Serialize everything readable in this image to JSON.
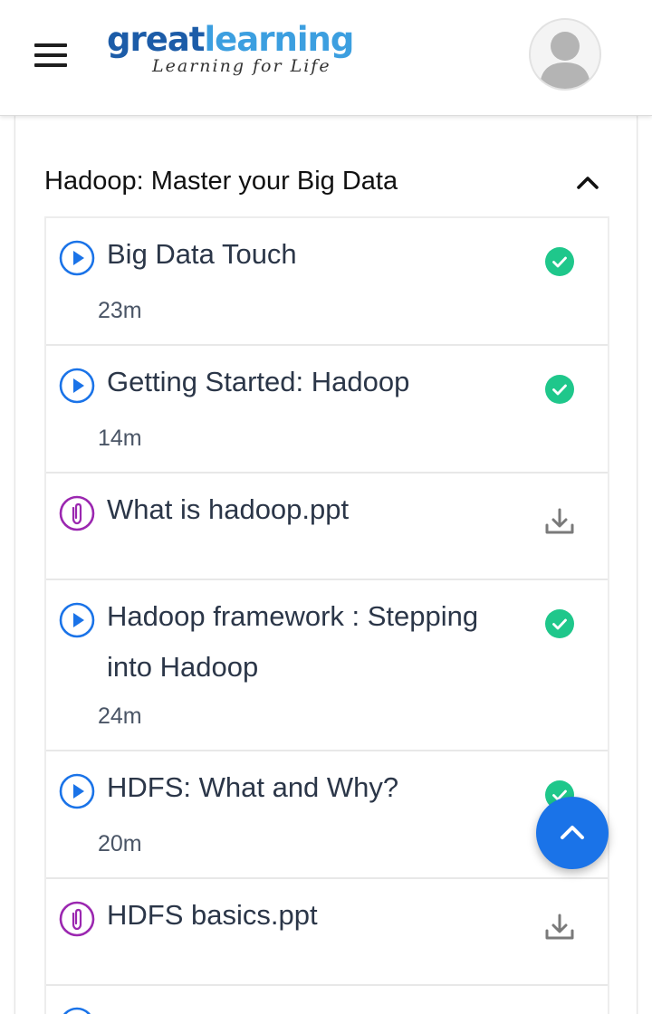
{
  "header": {
    "logo_great": "great",
    "logo_learning": "learning",
    "logo_tagline": "Learning for Life"
  },
  "section": {
    "title": "Hadoop: Master your Big Data",
    "items": [
      {
        "type": "video",
        "title": "Big Data Touch",
        "duration": "23m",
        "status": "completed"
      },
      {
        "type": "video",
        "title": "Getting Started: Hadoop",
        "duration": "14m",
        "status": "completed"
      },
      {
        "type": "attachment",
        "title": "What is hadoop.ppt",
        "action": "download"
      },
      {
        "type": "video",
        "title": "Hadoop framework : Stepping into Hadoop",
        "duration": "24m",
        "status": "completed"
      },
      {
        "type": "video",
        "title": "HDFS: What and Why?",
        "duration": "20m",
        "status": "completed"
      },
      {
        "type": "attachment",
        "title": "HDFS basics.ppt",
        "action": "download"
      }
    ]
  },
  "colors": {
    "video_icon": "#1a73e8",
    "attachment_icon": "#9b27b0",
    "completed": "#1fc78b",
    "download": "#7a7a7a",
    "fab": "#1a73e8"
  },
  "icons": {
    "menu": "hamburger-menu-icon",
    "avatar": "user-avatar-icon",
    "collapse": "chevron-up-icon",
    "video": "play-circle-icon",
    "attachment": "paperclip-icon",
    "completed": "check-circle-icon",
    "download": "download-icon",
    "scroll_top": "chevron-up-icon"
  }
}
